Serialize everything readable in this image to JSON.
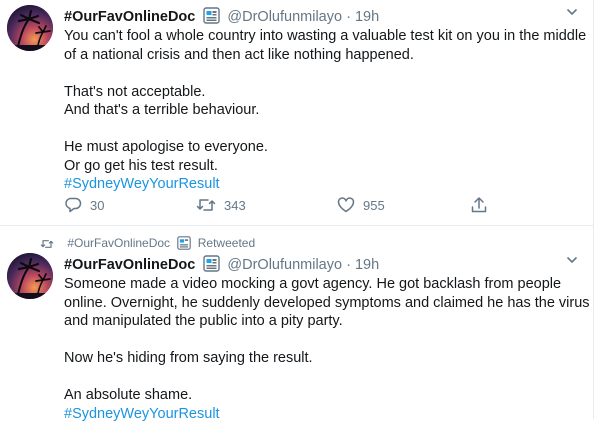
{
  "tweets": [
    {
      "display_name": "#OurFavOnlineDoc",
      "handle": "@DrOlufunmilayo",
      "dot": "·",
      "time": "19h",
      "lines": [
        "You can't fool a whole country into wasting a valuable test kit on you in the middle",
        "of a national crisis and then act like nothing happened.",
        "",
        "That's not acceptable.",
        "And that's a terrible behaviour.",
        "",
        "He must apologise to everyone.",
        "Or go get his test result."
      ],
      "hashtag": "#SydneyWeyYourResult",
      "stats": {
        "replies": "30",
        "retweets": "343",
        "likes": "955"
      }
    },
    {
      "retweeted_by": "#OurFavOnlineDoc",
      "retweeted_label": "Retweeted",
      "display_name": "#OurFavOnlineDoc",
      "handle": "@DrOlufunmilayo",
      "dot": "·",
      "time": "19h",
      "lines": [
        "Someone made a video mocking a govt agency. He got backlash from people",
        "online. Overnight, he suddenly developed symptoms and claimed he has the virus",
        "and manipulated the public into a pity party.",
        "",
        "Now he's hiding from saying the result.",
        "",
        "An absolute shame."
      ],
      "hashtag": "#SydneyWeyYourResult"
    }
  ],
  "icons": {
    "verified": "verified-badge-icon",
    "more": "chevron-down-icon",
    "reply": "reply-icon",
    "retweet": "retweet-icon",
    "like": "heart-icon",
    "share": "share-icon"
  },
  "colors": {
    "link": "#1b95e0",
    "secondary_text": "#657786",
    "verified_badge": "#1da1f2",
    "divider": "#e6ecf0"
  }
}
